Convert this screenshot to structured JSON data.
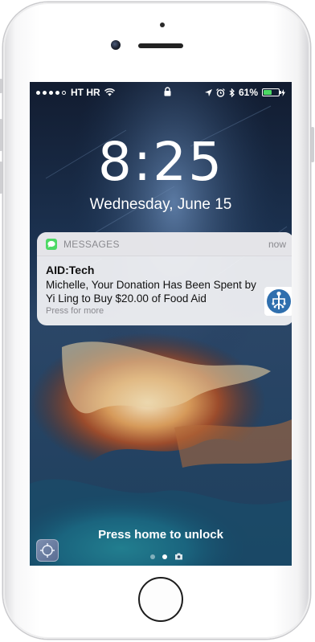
{
  "status_bar": {
    "carrier": "HT HR",
    "battery_text": "61%",
    "battery_level": 0.61
  },
  "lock_screen": {
    "time": "8:25",
    "date": "Wednesday, June 15",
    "unlock_hint": "Press home to unlock"
  },
  "notification": {
    "app_name": "MESSAGES",
    "time": "now",
    "sender": "AID:Tech",
    "body": "Michelle, Your Donation Has Been Spent by Yi Ling to Buy $20.00 of Food Aid",
    "hint": "Press for more"
  },
  "page_indicator": {
    "pages": 2,
    "active": 2
  },
  "colors": {
    "messages_green": "#4cd964",
    "aid_blue": "#2f6fae"
  },
  "icons": [
    "messages-icon",
    "aid-tech-app-icon",
    "camera-icon",
    "lock-icon",
    "location-icon",
    "alarm-icon",
    "bluetooth-icon",
    "wifi-icon",
    "signal-dots"
  ]
}
